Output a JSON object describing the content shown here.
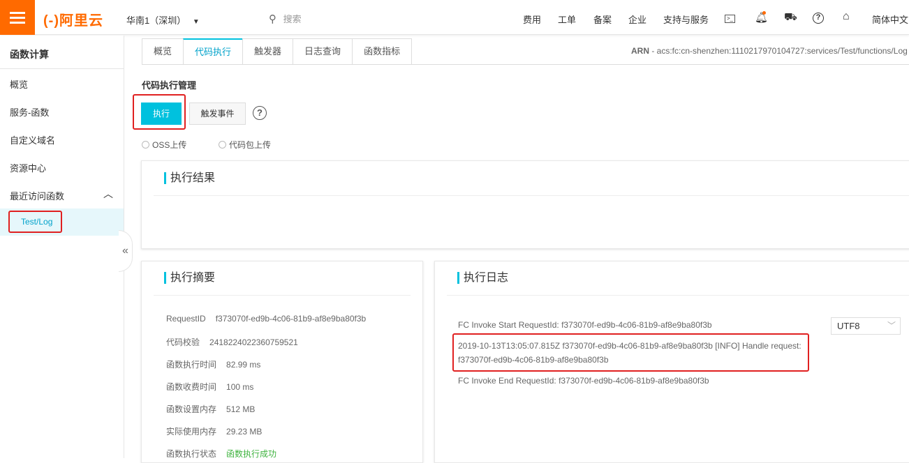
{
  "header": {
    "logo": "(-)阿里云",
    "region": "华南1（深圳）",
    "search_placeholder": "搜索",
    "nav": [
      "费用",
      "工单",
      "备案",
      "企业",
      "支持与服务"
    ],
    "language": "简体中文"
  },
  "sidebar": {
    "title": "函数计算",
    "items": [
      "概览",
      "服务-函数",
      "自定义域名",
      "资源中心",
      "最近访问函数"
    ],
    "recent": "Test/Log",
    "collapse": "«"
  },
  "tabs": [
    "概览",
    "代码执行",
    "触发器",
    "日志查询",
    "函数指标"
  ],
  "arn": {
    "label": "ARN",
    "value": " - acs:fc:cn-shenzhen:1110217970104727:services/Test/functions/Log"
  },
  "exec": {
    "title": "代码执行管理",
    "run": "执行",
    "trigger_event": "触发事件",
    "help": "?",
    "upload_options": [
      "OSS上传",
      "代码包上传"
    ]
  },
  "result": {
    "title": "执行结果"
  },
  "summary": {
    "title": "执行摘要",
    "rows": [
      {
        "k": "RequestID",
        "v": "f373070f-ed9b-4c06-81b9-af8e9ba80f3b"
      },
      {
        "k": "代码校验",
        "v": "2418224022360759521"
      },
      {
        "k": "函数执行时间",
        "v": "82.99 ms"
      },
      {
        "k": "函数收费时间",
        "v": "100 ms"
      },
      {
        "k": "函数设置内存",
        "v": "512 MB"
      },
      {
        "k": "实际使用内存",
        "v": "29.23 MB"
      },
      {
        "k": "函数执行状态",
        "v": "函数执行成功"
      }
    ]
  },
  "logs": {
    "title": "执行日志",
    "encoding": "UTF8",
    "lines": [
      "FC Invoke Start RequestId: f373070f-ed9b-4c06-81b9-af8e9ba80f3b",
      "2019-10-13T13:05:07.815Z f373070f-ed9b-4c06-81b9-af8e9ba80f3b [INFO] Handle request:",
      "f373070f-ed9b-4c06-81b9-af8e9ba80f3b",
      "FC Invoke End RequestId: f373070f-ed9b-4c06-81b9-af8e9ba80f3b"
    ]
  },
  "colors": {
    "brand": "#ff6a00",
    "accent": "#00c1de",
    "highlight": "#e02020",
    "success": "#3fb33f"
  }
}
